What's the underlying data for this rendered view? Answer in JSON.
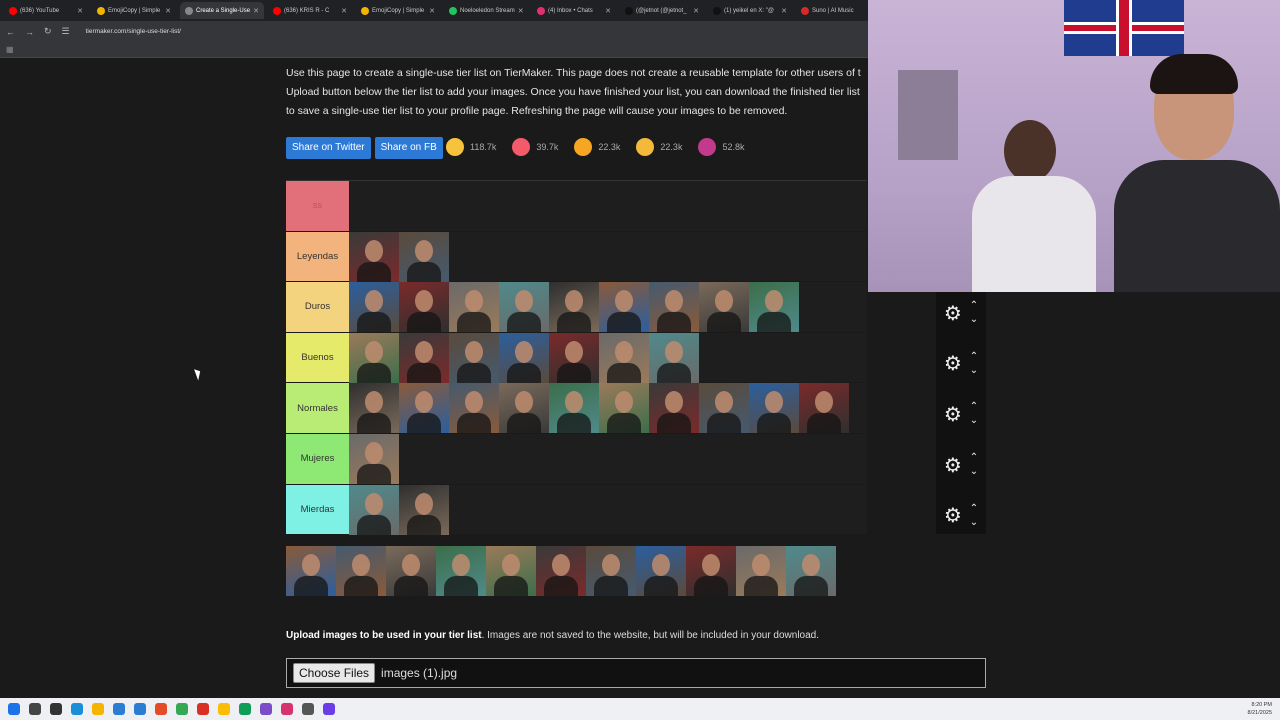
{
  "browser": {
    "tabs": [
      {
        "title": "(636) YouTube",
        "color": "#ff0000",
        "active": false
      },
      {
        "title": "EmojiCopy | Simple",
        "color": "#f2b400",
        "active": false
      },
      {
        "title": "Create a Single-Use",
        "color": "#888888",
        "active": true
      },
      {
        "title": "(636) KRIS R - C",
        "color": "#ff0000",
        "active": false
      },
      {
        "title": "EmojiCopy | Simple",
        "color": "#f2b400",
        "active": false
      },
      {
        "title": "Noeloeledon Stream",
        "color": "#21c55d",
        "active": false
      },
      {
        "title": "(4) Inbox • Chats",
        "color": "#e1306c",
        "active": false
      },
      {
        "title": "(@jetnot (@jetnot_",
        "color": "#111111",
        "active": false
      },
      {
        "title": "(1) yeikel en X: \"@",
        "color": "#111111",
        "active": false
      },
      {
        "title": "Suno | AI Music",
        "color": "#d62a2a",
        "active": false
      }
    ],
    "url": "tiermaker.com/single-use-tier-list/"
  },
  "intro_lines": [
    "Use this page to create a single-use tier list on TierMaker. This page does not create a reusable template for other users of t",
    "Upload button below the tier list to add your images. Once you have finished your list, you can download the finished tier list",
    "to save a single-use tier list to your profile page. Refreshing the page will cause your images to be removed."
  ],
  "share": {
    "twitter": "Share on Twitter",
    "fb": "Share on FB"
  },
  "reactions": [
    {
      "count": "118.7k",
      "color": "#f7c23c"
    },
    {
      "count": "39.7k",
      "color": "#f35b6b"
    },
    {
      "count": "22.3k",
      "color": "#f6a623"
    },
    {
      "count": "22.3k",
      "color": "#f4b93a"
    },
    {
      "count": "52.8k",
      "color": "#c23a8c"
    }
  ],
  "tiers": [
    {
      "label": "ss",
      "color": "#e2707a",
      "count": 0
    },
    {
      "label": "Leyendas",
      "color": "#f2b37c",
      "count": 2
    },
    {
      "label": "Duros",
      "color": "#f4d37f",
      "count": 9
    },
    {
      "label": "Buenos",
      "color": "#e6ea6a",
      "count": 7
    },
    {
      "label": "Normales",
      "color": "#b8ec74",
      "count": 10
    },
    {
      "label": "Mujeres",
      "color": "#8ee874",
      "count": 1
    },
    {
      "label": "Mierdas",
      "color": "#7ef0e4",
      "count": 2
    }
  ],
  "unranked_count": 11,
  "upload": {
    "bold": "Upload images to be used in your tier list",
    "rest": ". Images are not saved to the website, but will be included in your download.",
    "button": "Choose Files",
    "filename": "images (1).jpg"
  },
  "clock": {
    "time": "8:20 PM",
    "date": "8/21/2025"
  }
}
